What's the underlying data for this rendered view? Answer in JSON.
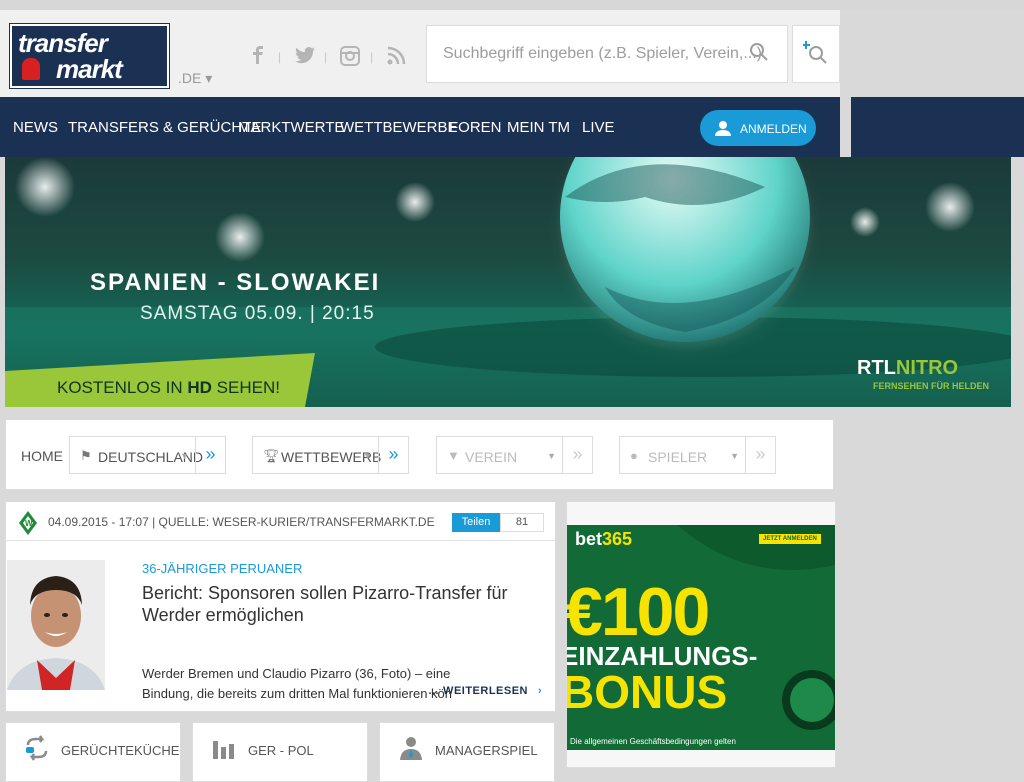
{
  "header": {
    "logo_line1": "transfer",
    "logo_line2": "markt",
    "logo_suffix": ".DE ▾",
    "social": [
      "f",
      "|",
      "t",
      "|",
      "ig",
      "|",
      "rss"
    ],
    "search_placeholder": "Suchbegriff eingeben (z.B. Spieler, Verein,...)"
  },
  "nav": {
    "items": [
      "NEWS",
      "TRANSFERS & GERÜCHTE",
      "MARKTWERTE",
      "WETTBEWERBE",
      "FOREN",
      "MEIN TM",
      "LIVE"
    ],
    "login": "ANMELDEN"
  },
  "banner": {
    "title": "SPANIEN - SLOWAKEI",
    "date": "SAMSTAG 05.09. | 20:15",
    "tag_prefix": "KOSTENLOS IN ",
    "tag_bold": "HD",
    "tag_suffix": " SEHEN!",
    "rtl_a": "RTL",
    "rtl_b": "NITRO",
    "rtl_sub": "FERNSEHEN FÜR HELDEN"
  },
  "breadcrumb": {
    "home": "HOME",
    "boxes": [
      {
        "label": "DEUTSCHLAND",
        "icon": "flag-icon",
        "enabled": true
      },
      {
        "label": "WETTBEWERB",
        "icon": "trophy-icon",
        "enabled": true
      },
      {
        "label": "VEREIN",
        "icon": "shirt-icon",
        "enabled": false
      },
      {
        "label": "SPIELER",
        "icon": "user-icon",
        "enabled": false
      }
    ]
  },
  "news": {
    "meta": "04.09.2015 - 17:07 | QUELLE: WESER-KURIER/TRANSFERMARKT.DE",
    "share": "Teilen",
    "share_count": "81",
    "kicker": "36-JÄHRIGER PERUANER",
    "headline": "Bericht: Sponsoren sollen Pizarro-Transfer für Werder ermöglichen",
    "body": "Werder Bremen und Claudio Pizarro (36, Foto) – eine Bindung, die bereits zum dritten Mal funktionieren kön",
    "more": "… WEITERLESEN",
    "more_arrow": "›"
  },
  "ad": {
    "brand_a": "bet",
    "brand_b": "365",
    "cta": "JETZT ANMELDEN",
    "big": "€100",
    "mid": "EINZAHLUNGS-",
    "bonus": "BONUS",
    "fine": "Die allgemeinen Geschäftsbedingungen gelten"
  },
  "tiles": [
    "GERÜCHTEKÜCHE",
    "GER - POL",
    "MANAGERSPIEL"
  ],
  "colors": {
    "navy": "#1b3154",
    "accent": "#1a9ad7",
    "bg": "#d9d9d9"
  }
}
